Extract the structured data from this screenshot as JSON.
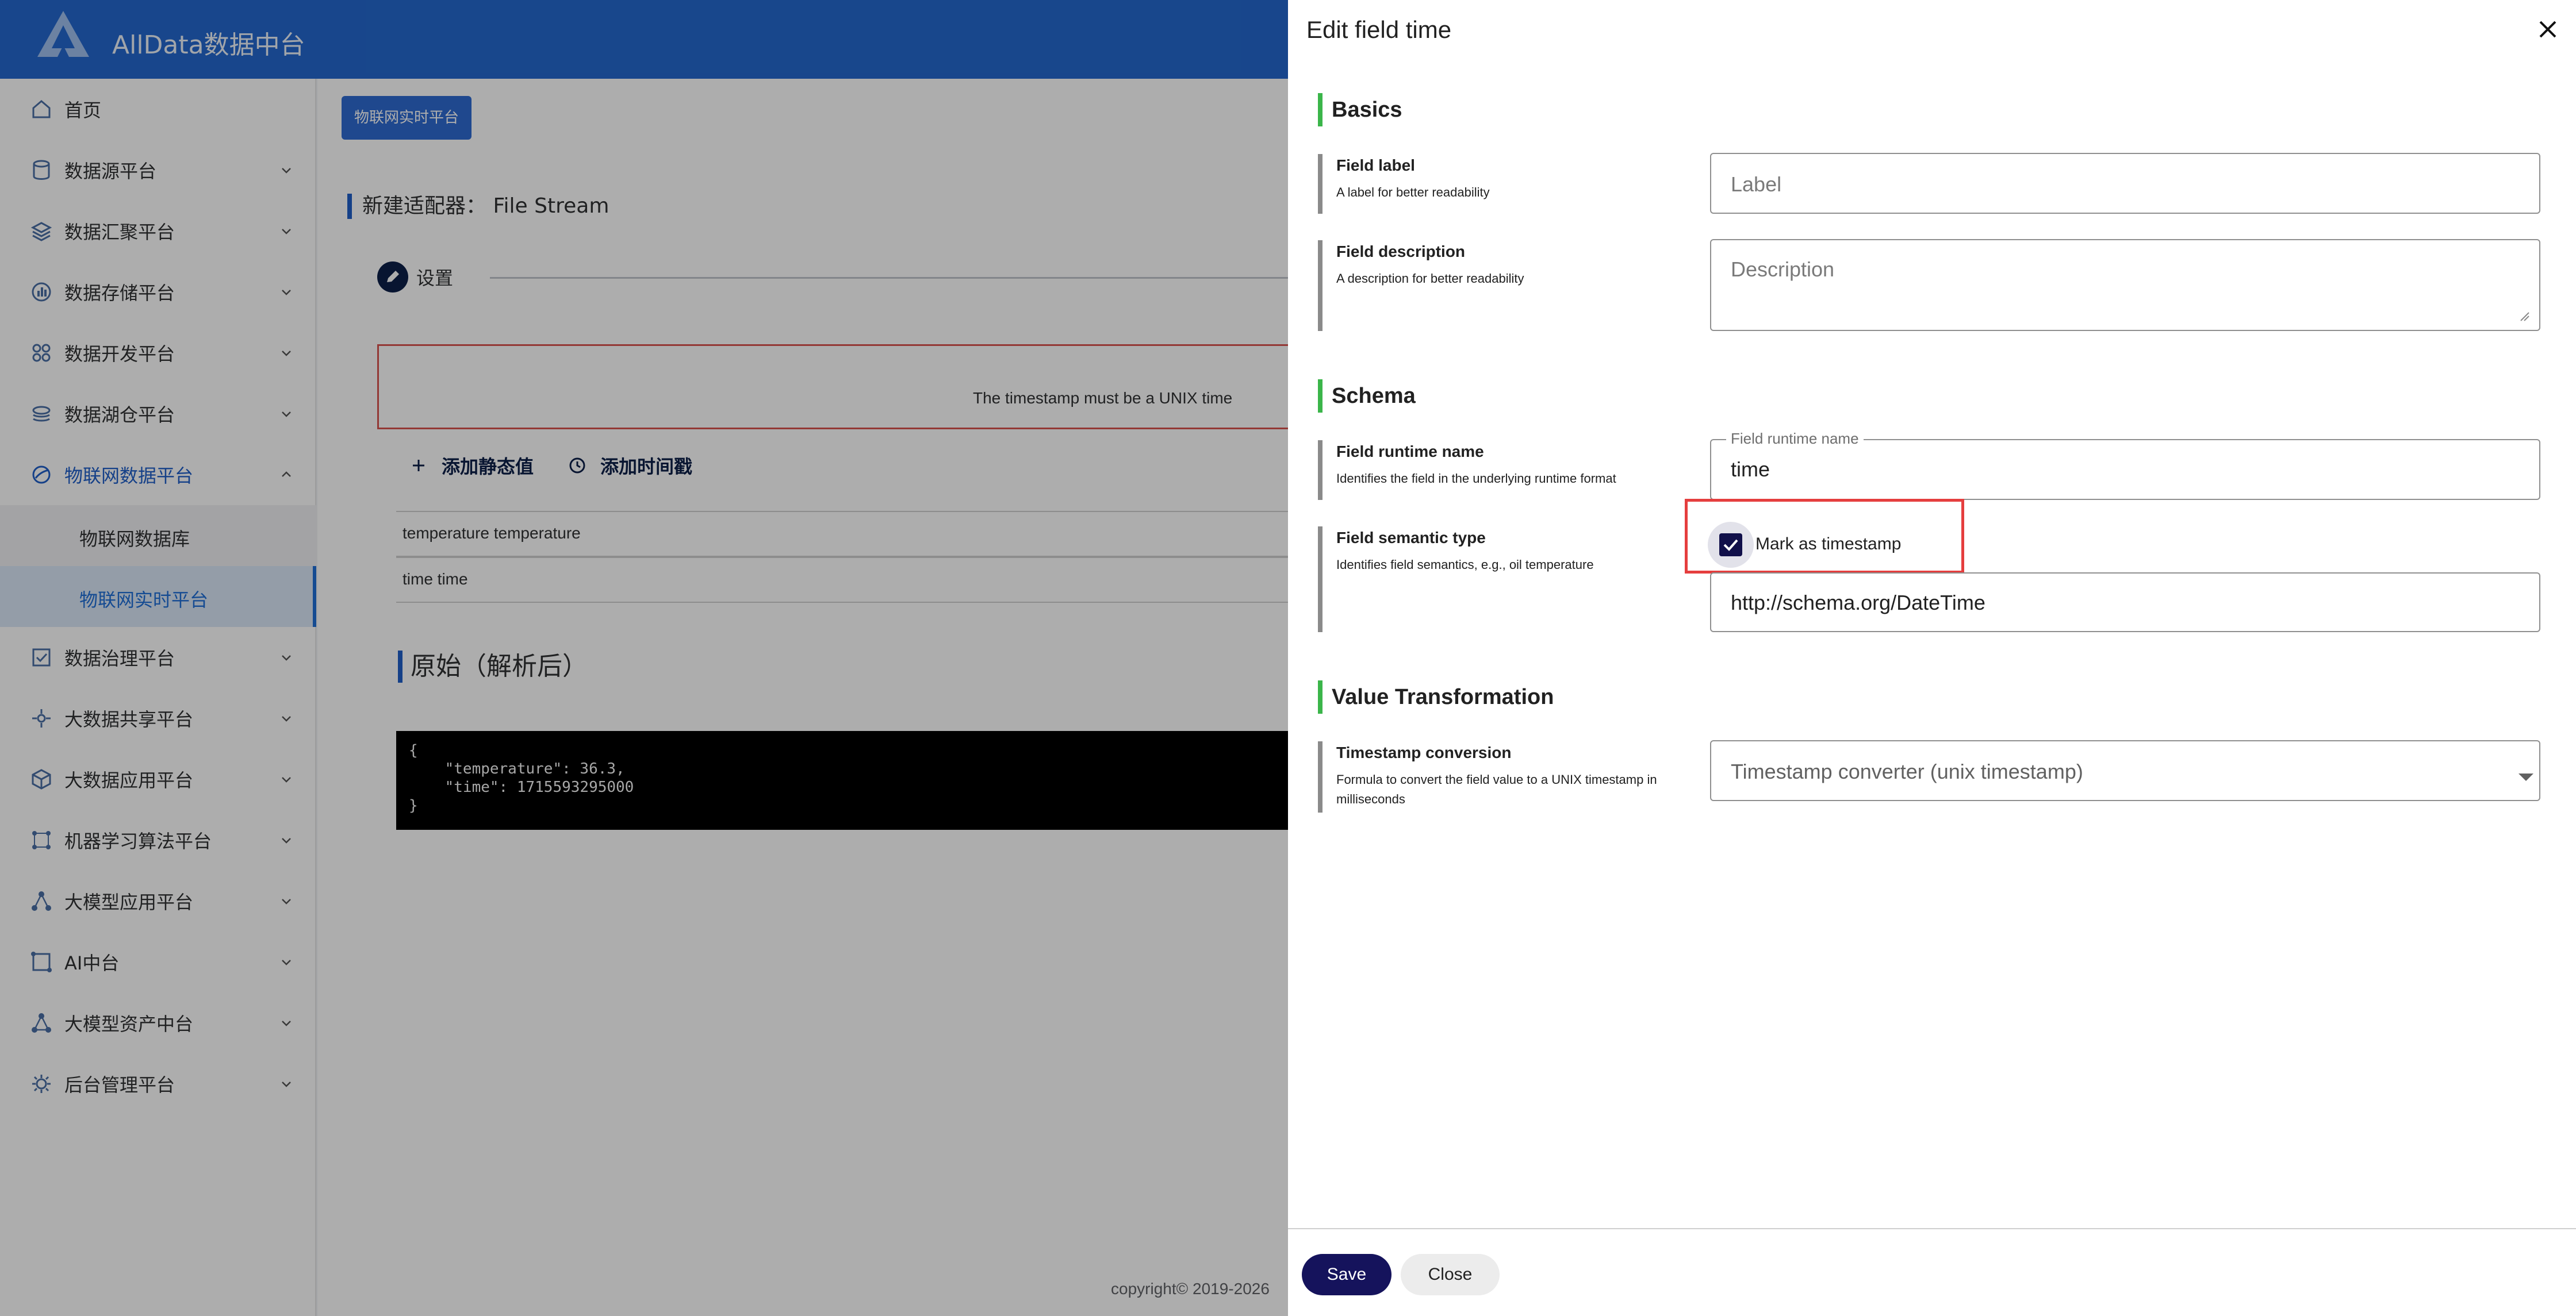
{
  "app": {
    "brand": "AllData数据中台"
  },
  "sidebar": {
    "items": [
      {
        "label": "首页",
        "icon": "home-icon"
      },
      {
        "label": "数据源平台",
        "icon": "database-icon"
      },
      {
        "label": "数据汇聚平台",
        "icon": "layers-icon"
      },
      {
        "label": "数据存储平台",
        "icon": "storage-icon"
      },
      {
        "label": "数据开发平台",
        "icon": "develop-icon"
      },
      {
        "label": "数据湖仓平台",
        "icon": "lake-icon"
      },
      {
        "label": "物联网数据平台",
        "icon": "iot-icon"
      },
      {
        "label": "数据治理平台",
        "icon": "governance-icon"
      },
      {
        "label": "大数据共享平台",
        "icon": "share-icon"
      },
      {
        "label": "大数据应用平台",
        "icon": "cube-icon"
      },
      {
        "label": "机器学习算法平台",
        "icon": "ml-icon"
      },
      {
        "label": "大模型应用平台",
        "icon": "model-icon"
      },
      {
        "label": "AI中台",
        "icon": "ai-icon"
      },
      {
        "label": "大模型资产中台",
        "icon": "asset-icon"
      },
      {
        "label": "后台管理平台",
        "icon": "admin-icon"
      }
    ],
    "subitems": [
      {
        "label": "物联网数据库"
      },
      {
        "label": "物联网实时平台"
      }
    ]
  },
  "main": {
    "crumb": "物联网实时平台",
    "adapter_title": "新建适配器：  File Stream",
    "step_label": "设置",
    "error_text": "The timestamp must be a UNIX time",
    "add_static": "添加静态值",
    "add_timestamp": "添加时间戳",
    "rows": [
      "temperature temperature",
      "time time"
    ],
    "raw_title": "原始（解析后）",
    "code": "{\n    \"temperature\": 36.3,\n    \"time\": 1715593295000\n}",
    "footer": "copyright© 2019-2026"
  },
  "dialog": {
    "title": "Edit field time",
    "basics": {
      "heading": "Basics",
      "label_title": "Field label",
      "label_desc": "A label for better readability",
      "label_placeholder": "Label",
      "desc_title": "Field description",
      "desc_desc": "A description for better readability",
      "desc_placeholder": "Description"
    },
    "schema": {
      "heading": "Schema",
      "runtime_title": "Field runtime name",
      "runtime_desc": "Identifies the field in the underlying runtime format",
      "runtime_float_label": "Field runtime name",
      "runtime_value": "time",
      "semantic_title": "Field semantic type",
      "semantic_desc": "Identifies field semantics, e.g., oil temperature",
      "mark_label": "Mark as timestamp",
      "mark_checked": true,
      "semantic_value": "http://schema.org/DateTime"
    },
    "transform": {
      "heading": "Value Transformation",
      "ts_title": "Timestamp conversion",
      "ts_desc": "Formula to convert the field value to a UNIX timestamp in milliseconds",
      "ts_value": "Timestamp converter (unix timestamp)"
    },
    "save_label": "Save",
    "close_label": "Close"
  },
  "colors": {
    "topbar": "#2468cf",
    "accent_green": "#3bb54a",
    "save_button": "#15135c",
    "highlight_red": "#e53e3e"
  }
}
